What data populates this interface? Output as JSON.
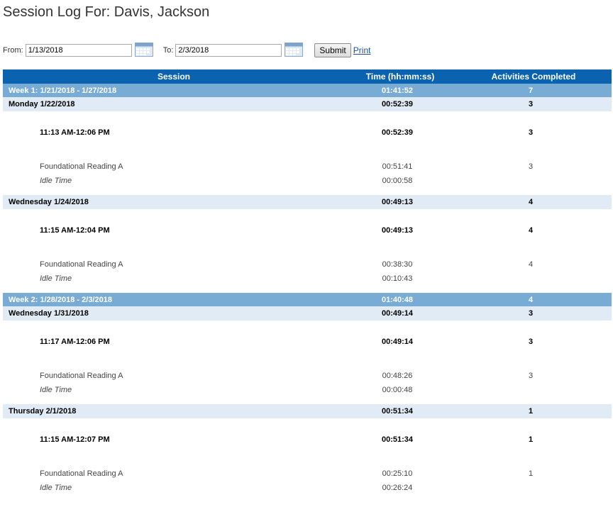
{
  "page": {
    "title": "Session Log For: Davis, Jackson"
  },
  "filters": {
    "from_label": "From:",
    "from_value": "1/13/2018",
    "to_label": "To:",
    "to_value": "2/3/2018",
    "submit_label": "Submit",
    "print_label": "Print",
    "calendar_icon": "calendar-icon"
  },
  "table": {
    "headers": {
      "session": "Session",
      "time": "Time (hh:mm:ss)",
      "activities": "Activities Completed"
    },
    "weeks": [
      {
        "label": "Week 1: 1/21/2018 - 1/27/2018",
        "time": "01:41:52",
        "activities": "7",
        "days": [
          {
            "label": "Monday 1/22/2018",
            "time": "00:52:39",
            "activities": "3",
            "session": {
              "label": "11:13 AM-12:06 PM",
              "time": "00:52:39",
              "activities": "3"
            },
            "activity": {
              "label": "Foundational Reading A",
              "time": "00:51:41",
              "activities": "3"
            },
            "idle": {
              "label": "Idle Time",
              "time": "00:00:58"
            }
          },
          {
            "label": "Wednesday 1/24/2018",
            "time": "00:49:13",
            "activities": "4",
            "session": {
              "label": "11:15 AM-12:04 PM",
              "time": "00:49:13",
              "activities": "4"
            },
            "activity": {
              "label": "Foundational Reading A",
              "time": "00:38:30",
              "activities": "4"
            },
            "idle": {
              "label": "Idle Time",
              "time": "00:10:43"
            }
          }
        ]
      },
      {
        "label": "Week 2: 1/28/2018 - 2/3/2018",
        "time": "01:40:48",
        "activities": "4",
        "days": [
          {
            "label": "Wednesday 1/31/2018",
            "time": "00:49:14",
            "activities": "3",
            "session": {
              "label": "11:17 AM-12:06 PM",
              "time": "00:49:14",
              "activities": "3"
            },
            "activity": {
              "label": "Foundational Reading A",
              "time": "00:48:26",
              "activities": "3"
            },
            "idle": {
              "label": "Idle Time",
              "time": "00:00:48"
            }
          },
          {
            "label": "Thursday 2/1/2018",
            "time": "00:51:34",
            "activities": "1",
            "session": {
              "label": "11:15 AM-12:07 PM",
              "time": "00:51:34",
              "activities": "1"
            },
            "activity": {
              "label": "Foundational Reading A",
              "time": "00:25:10",
              "activities": "1"
            },
            "idle": {
              "label": "Idle Time",
              "time": "00:26:24"
            }
          }
        ]
      }
    ]
  }
}
